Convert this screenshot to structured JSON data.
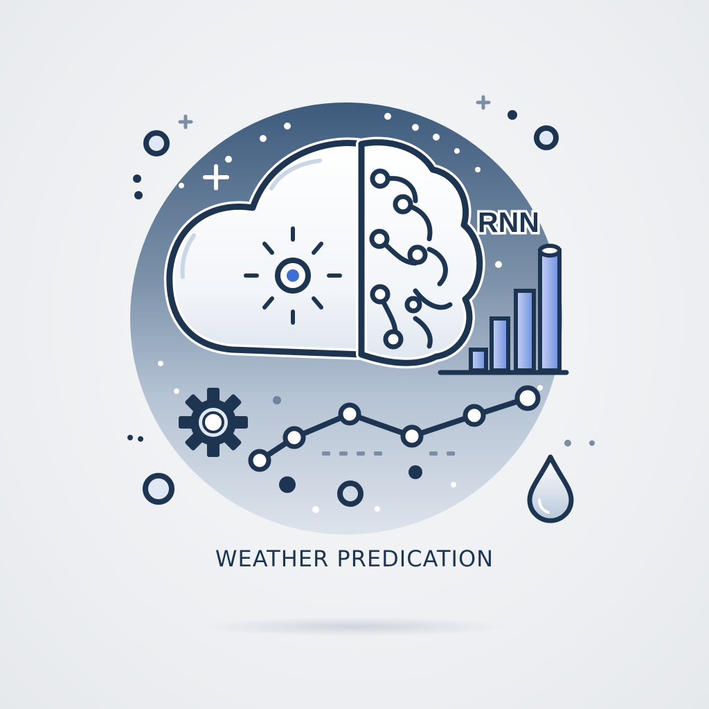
{
  "image": {
    "badge_label": "RNN",
    "caption": "WEATHER PREDICATION"
  },
  "palette": {
    "navy": "#1d3551",
    "steel": "#7b8ea5",
    "pale_blue": "#c9d6e6",
    "accent_blue": "#4a78d8",
    "background": "#eff1f3"
  },
  "icons": [
    "cloud-icon",
    "sun-icon",
    "brain-icon",
    "bar-chart-icon",
    "gear-icon",
    "line-graph-icon",
    "raindrop-icon",
    "sparkle-icon"
  ]
}
